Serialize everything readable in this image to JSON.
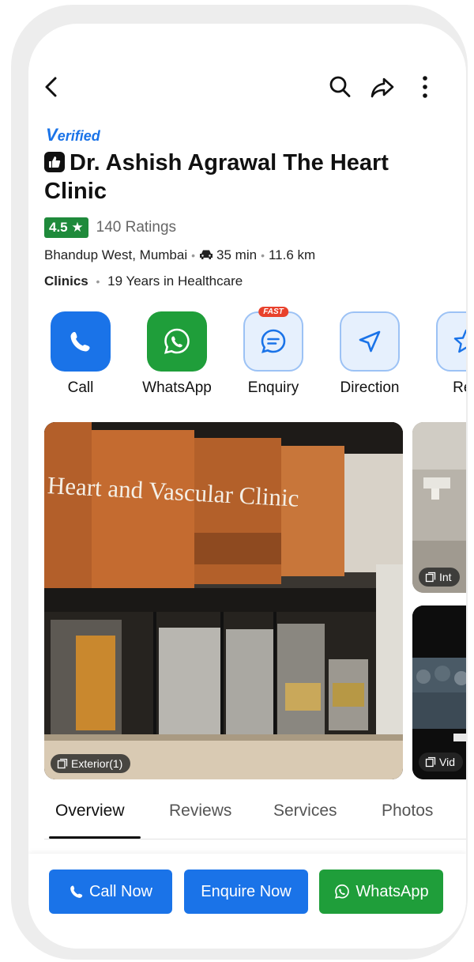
{
  "colors": {
    "accent_blue": "#1a73e8",
    "whatsapp_green": "#1f9e3a",
    "rating_green": "#1f8a3b",
    "fast_badge_red": "#e8412c"
  },
  "header": {
    "icons": [
      "back-arrow-icon",
      "search-icon",
      "share-icon",
      "more-vertical-icon"
    ]
  },
  "listing": {
    "verified_first": "V",
    "verified_rest": "erified",
    "title": "Dr. Ashish Agrawal The Heart Clinic",
    "rating": "4.5",
    "rating_star": "★",
    "ratings_count": "140 Ratings",
    "location": "Bhandup West, Mumbai",
    "drive_time": "35 min",
    "distance": "11.6 km",
    "category": "Clinics",
    "experience": "19 Years in Healthcare"
  },
  "actions": [
    {
      "label": "Call",
      "icon": "phone-icon"
    },
    {
      "label": "WhatsApp",
      "icon": "whatsapp-icon"
    },
    {
      "label": "Enquiry",
      "icon": "chat-bubble-icon",
      "badge": "FAST"
    },
    {
      "label": "Direction",
      "icon": "navigation-arrow-icon"
    },
    {
      "label": "Rev",
      "icon": "star-icon"
    }
  ],
  "photos": {
    "main_signage": "Heart and Vascular Clinic",
    "main_tag": "Exterior(1)",
    "side1_tag": "Int",
    "side2_tag": "Vid"
  },
  "tabs": [
    "Overview",
    "Reviews",
    "Services",
    "Photos"
  ],
  "bottom_buttons": {
    "call": "Call Now",
    "enquire": "Enquire Now",
    "whatsapp": "WhatsApp"
  }
}
